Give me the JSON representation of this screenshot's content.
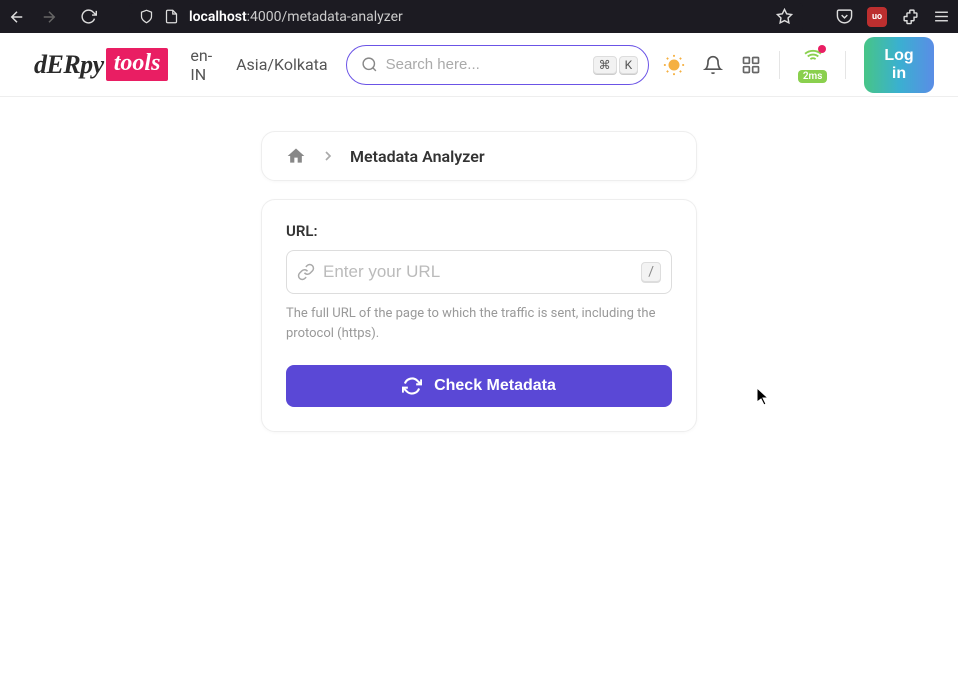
{
  "browser": {
    "url_host": "localhost",
    "url_rest": ":4000/metadata-analyzer",
    "ublock": "uo"
  },
  "header": {
    "locale": "en-IN",
    "timezone": "Asia/Kolkata",
    "search_placeholder": "Search here...",
    "kbd1": "⌘",
    "kbd2": "K",
    "latency": "2ms",
    "login": "Log in"
  },
  "breadcrumb": {
    "current": "Metadata Analyzer"
  },
  "form": {
    "label": "URL:",
    "placeholder": "Enter your URL",
    "shortcut": "/",
    "help": "The full URL of the page to which the traffic is sent, including the protocol (https).",
    "submit": "Check Metadata"
  }
}
